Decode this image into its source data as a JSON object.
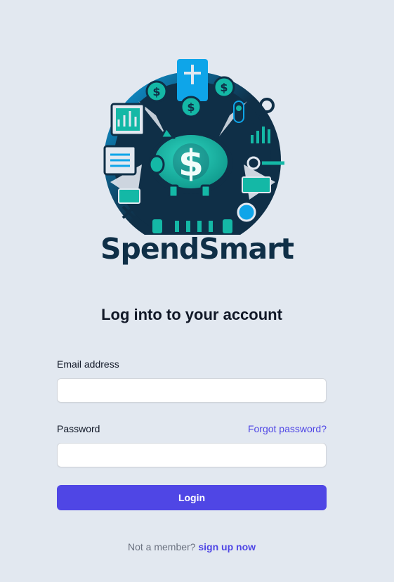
{
  "brand": {
    "name": "SpendSmart",
    "logo_icon": "piggy-bank-dollar-icon",
    "logo_glyph": "$",
    "colors": {
      "navy": "#0f2f47",
      "teal": "#14b8a6",
      "blue": "#0ea5e9",
      "bg": "#e2e8f0"
    }
  },
  "page": {
    "title": "Log into to your account"
  },
  "form": {
    "email_label": "Email address",
    "email_value": "",
    "password_label": "Password",
    "password_value": "",
    "forgot_label": "Forgot password?",
    "login_label": "Login"
  },
  "signup": {
    "prompt": "Not a member?",
    "link_label": "sign up now"
  },
  "colors": {
    "accent": "#4f46e5",
    "muted_text": "#6b7280"
  }
}
